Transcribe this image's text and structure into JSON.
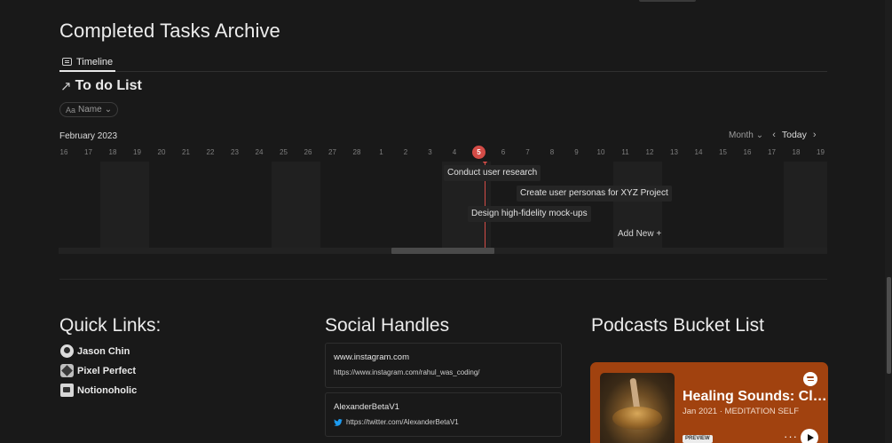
{
  "page": {
    "title": "Completed Tasks Archive"
  },
  "view_tabs": [
    {
      "label": "Timeline",
      "icon": "timeline-icon",
      "active": true
    }
  ],
  "database": {
    "title": "To do List",
    "arrow_icon": "north-east-arrow-icon",
    "filter": {
      "prefix": "Aa",
      "label": "Name",
      "chevron": "⌄"
    }
  },
  "timeline": {
    "month_label": "February 2023",
    "scale": "Month",
    "today_label": "Today",
    "days": [
      "16",
      "17",
      "18",
      "19",
      "20",
      "21",
      "22",
      "23",
      "24",
      "25",
      "26",
      "27",
      "28",
      "1",
      "2",
      "3",
      "4",
      "5",
      "6",
      "7",
      "8",
      "9",
      "10",
      "11",
      "12",
      "13",
      "14",
      "15",
      "16",
      "17",
      "18",
      "19"
    ],
    "today_day": "5",
    "tasks": [
      {
        "label": "Conduct user research"
      },
      {
        "label": "Create user personas for XYZ Project"
      },
      {
        "label": "Design high-fidelity mock-ups"
      }
    ],
    "add_new_label": "Add New +",
    "today_color": "#d44c47"
  },
  "quick_links": {
    "title": "Quick Links:",
    "items": [
      {
        "label": "Jason Chin",
        "icon": "avatar-icon"
      },
      {
        "label": "Pixel Perfect",
        "icon": "pixel-perfect-icon"
      },
      {
        "label": "Notionoholic",
        "icon": "notionoholic-icon"
      }
    ]
  },
  "social": {
    "title": "Social Handles",
    "bookmarks": [
      {
        "title": "www.instagram.com",
        "url": "https://www.instagram.com/rahul_was_coding/",
        "icon": ""
      },
      {
        "title": "AlexanderBetaV1",
        "url": "https://twitter.com/AlexanderBetaV1",
        "icon": "twitter-icon"
      }
    ]
  },
  "podcasts": {
    "title": "Podcasts Bucket List",
    "card": {
      "name": "Healing Sounds: Cl…",
      "meta": "Jan 2021 · MEDITATION SELF",
      "badge": "PREVIEW",
      "more": "···",
      "background": "#a1420f"
    }
  }
}
